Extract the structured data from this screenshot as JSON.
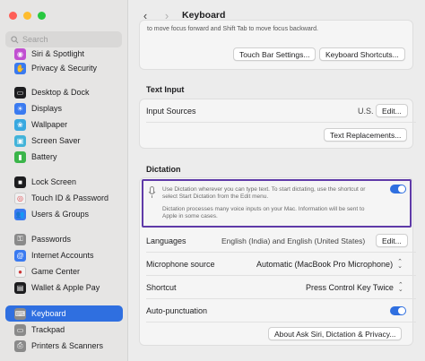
{
  "colors": {
    "accent": "#2f6fe0",
    "highlight_border": "#5f3aa8"
  },
  "window": {
    "title": "Keyboard"
  },
  "search": {
    "placeholder": "Search"
  },
  "sidebar": {
    "items": [
      {
        "label": "Siri & Spotlight",
        "icon": "siri-icon",
        "color": "#c14fd1"
      },
      {
        "label": "Privacy & Security",
        "icon": "hand-icon",
        "color": "#3a7af0"
      },
      {
        "label": "Desktop & Dock",
        "icon": "dock-icon",
        "color": "#1d1d1f"
      },
      {
        "label": "Displays",
        "icon": "sun-icon",
        "color": "#3a7af0"
      },
      {
        "label": "Wallpaper",
        "icon": "wallpaper-icon",
        "color": "#38a8e0"
      },
      {
        "label": "Screen Saver",
        "icon": "screensaver-icon",
        "color": "#42b3d9"
      },
      {
        "label": "Battery",
        "icon": "battery-icon",
        "color": "#3bb54a"
      },
      {
        "label": "Lock Screen",
        "icon": "lock-icon",
        "color": "#1d1d1f"
      },
      {
        "label": "Touch ID & Password",
        "icon": "fingerprint-icon",
        "color": "#e5e5e5"
      },
      {
        "label": "Users & Groups",
        "icon": "users-icon",
        "color": "#3a7af0"
      },
      {
        "label": "Passwords",
        "icon": "key-icon",
        "color": "#8a8a8a"
      },
      {
        "label": "Internet Accounts",
        "icon": "at-icon",
        "color": "#3a7af0"
      },
      {
        "label": "Game Center",
        "icon": "gamecenter-icon",
        "color": "#f2f2f2"
      },
      {
        "label": "Wallet & Apple Pay",
        "icon": "wallet-icon",
        "color": "#1d1d1f"
      },
      {
        "label": "Keyboard",
        "icon": "keyboard-icon",
        "color": "#8a8a8a"
      },
      {
        "label": "Trackpad",
        "icon": "trackpad-icon",
        "color": "#8a8a8a"
      },
      {
        "label": "Printers & Scanners",
        "icon": "printer-icon",
        "color": "#8a8a8a"
      }
    ]
  },
  "navigation": {
    "hint": "to move focus forward and Shift Tab to move focus backward.",
    "touch_bar_button": "Touch Bar Settings...",
    "shortcuts_button": "Keyboard Shortcuts..."
  },
  "text_input": {
    "heading": "Text Input",
    "input_sources_label": "Input Sources",
    "input_sources_value": "U.S.",
    "edit_button": "Edit...",
    "replacements_button": "Text Replacements..."
  },
  "dictation": {
    "heading": "Dictation",
    "description": "Use Dictation wherever you can type text. To start dictating, use the shortcut or select Start Dictation from the Edit menu.",
    "privacy_note": "Dictation processes many voice inputs on your Mac. Information will be sent to Apple in some cases.",
    "enabled": true,
    "languages_label": "Languages",
    "languages_value": "English (India) and English (United States)",
    "languages_edit": "Edit...",
    "mic_label": "Microphone source",
    "mic_value": "Automatic (MacBook Pro Microphone)",
    "shortcut_label": "Shortcut",
    "shortcut_value": "Press Control Key Twice",
    "autopunct_label": "Auto-punctuation",
    "autopunct_enabled": true,
    "about_button": "About Ask Siri, Dictation & Privacy..."
  }
}
